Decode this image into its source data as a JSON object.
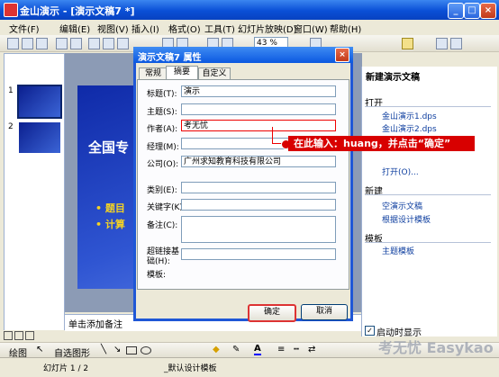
{
  "window": {
    "title": "金山演示 - [演示文稿7 *]"
  },
  "menu": [
    "文件(F)",
    "编辑(E)",
    "视图(V)",
    "插入(I)",
    "格式(O)",
    "工具(T)",
    "幻灯片放映(D)",
    "窗口(W)",
    "帮助(H)"
  ],
  "toolbar": {
    "zoom": "43 %"
  },
  "slides": {
    "numbers": [
      "1",
      "2"
    ]
  },
  "slide": {
    "title": "全国专",
    "bullets": [
      "• 题目",
      "• 计算"
    ]
  },
  "notes": {
    "placeholder": "单击添加备注"
  },
  "task_pane": {
    "title": "新建演示文稿",
    "open_section": "打开",
    "recent": [
      "金山演示1.dps",
      "金山演示2.dps"
    ],
    "open_link": "打开(O)...",
    "new_section": "新建",
    "new_blank": "空演示文稿",
    "new_template": "根据设计模板",
    "template_section": "模板",
    "template_link": "主题模板",
    "startup_checkbox": "启动时显示"
  },
  "dialog": {
    "title": "演示文稿7 属性",
    "tabs": [
      "常规",
      "摘要",
      "自定义"
    ],
    "fields": {
      "title_label": "标题(T):",
      "title_value": "演示",
      "subject_label": "主题(S):",
      "subject_value": "",
      "author_label": "作者(A):",
      "author_value": "考无忧",
      "manager_label": "经理(M):",
      "manager_value": "",
      "company_label": "公司(O):",
      "company_value": "广州求知教育科技有限公司",
      "category_label": "类别(E):",
      "category_value": "",
      "keywords_label": "关键字(K):",
      "keywords_value": "",
      "comments_label": "备注(C):",
      "comments_value": "",
      "hyperlink_label": "超链接基础(H):",
      "hyperlink_value": "",
      "template_label": "模板:"
    },
    "ok": "确定",
    "cancel": "取消"
  },
  "callout": {
    "text": "在此输入：huang，并点击“确定”"
  },
  "drawbar": {
    "draw": "绘图",
    "autoshape": "自选图形"
  },
  "status": {
    "slide": "幻灯片 1 / 2",
    "template": "_默认设计模板"
  },
  "watermark": {
    "text": "考无忧 Easykao"
  }
}
